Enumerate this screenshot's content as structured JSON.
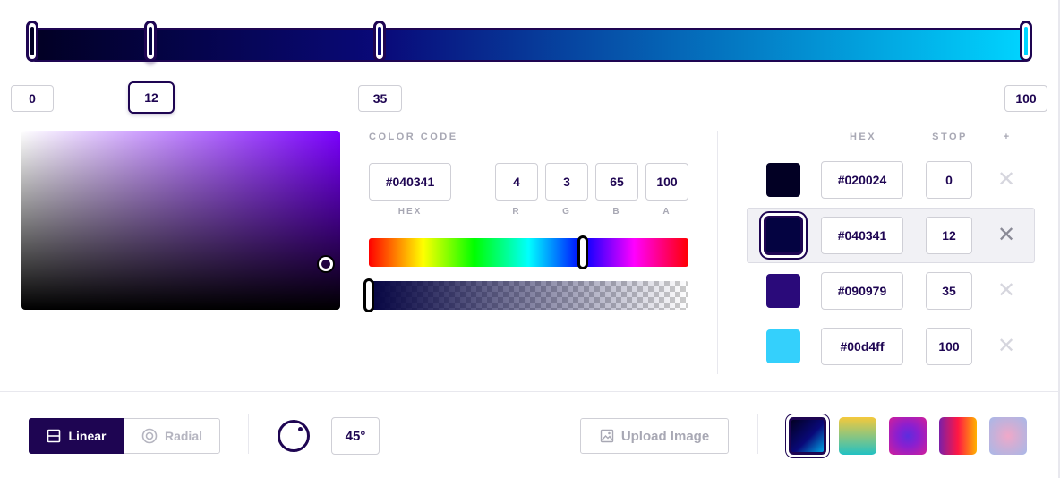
{
  "stops": [
    {
      "position": 0,
      "hex": "#020024",
      "label": "0"
    },
    {
      "position": 12,
      "hex": "#040341",
      "label": "12",
      "active": true
    },
    {
      "position": 35,
      "hex": "#090979",
      "label": "35"
    },
    {
      "position": 100,
      "hex": "#00d4ff",
      "label": "100"
    }
  ],
  "picker": {
    "section_label": "COLOR CODE",
    "hex_value": "#040341",
    "hex_label": "HEX",
    "r": "4",
    "g": "3",
    "b": "65",
    "a": "100",
    "r_label": "R",
    "g_label": "G",
    "b_label": "B",
    "a_label": "A",
    "hue_degrees": 242,
    "alpha_percent": 100
  },
  "stop_list": {
    "hex_header": "HEX",
    "stop_header": "STOP",
    "add_icon": "+",
    "rows": [
      {
        "hex": "#020024",
        "stop": "0",
        "remove": "✕"
      },
      {
        "hex": "#040341",
        "stop": "12",
        "remove": "✕",
        "selected": true
      },
      {
        "hex": "#090979",
        "stop": "35",
        "remove": "✕"
      },
      {
        "hex": "#00d4ff",
        "stop": "100",
        "remove": "✕"
      }
    ]
  },
  "toolbar": {
    "linear_label": "Linear",
    "radial_label": "Radial",
    "angle_value": "45°",
    "upload_label": "Upload Image"
  },
  "presets": [
    {
      "name": "preset-navy-blue",
      "selected": true
    },
    {
      "name": "preset-yellow-teal"
    },
    {
      "name": "preset-purple-radial"
    },
    {
      "name": "preset-red-purple"
    },
    {
      "name": "preset-pastel-radial"
    }
  ],
  "colors": {
    "accent": "#1e0552",
    "muted": "#a8a8b4",
    "border": "#cfcfd6"
  }
}
